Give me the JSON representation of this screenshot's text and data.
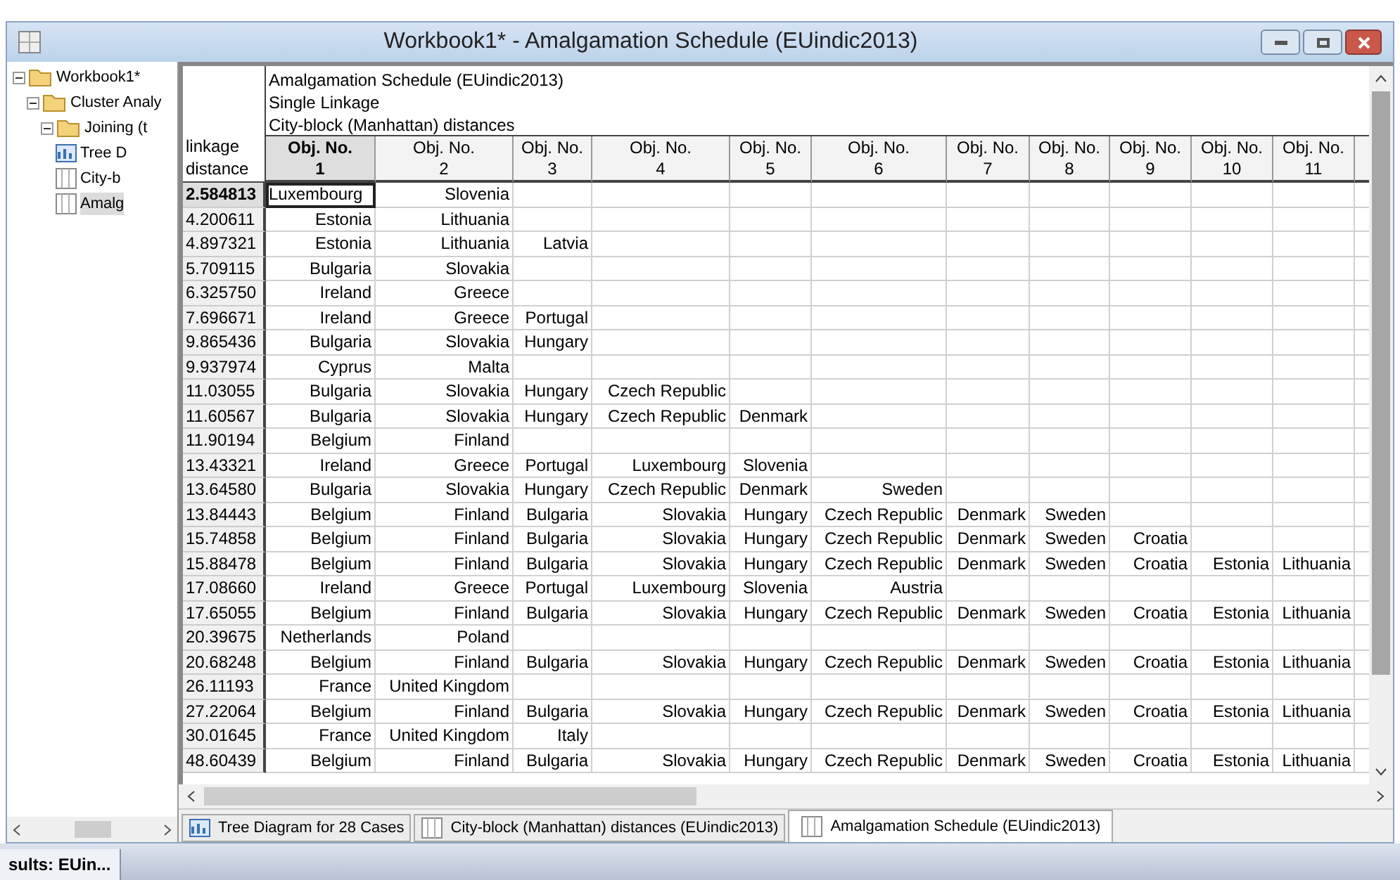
{
  "window": {
    "title": "Workbook1* - Amalgamation Schedule (EUindic2013)"
  },
  "tree": [
    {
      "label": "Workbook1*",
      "kind": "folder",
      "expanded": true,
      "selected": false,
      "children": [
        {
          "label": "Cluster Analy",
          "kind": "folder",
          "expanded": true,
          "selected": false,
          "children": [
            {
              "label": "Joining (t",
              "kind": "folder",
              "expanded": true,
              "selected": false,
              "children": [
                {
                  "label": "Tree D",
                  "kind": "graph",
                  "selected": false
                },
                {
                  "label": "City-b",
                  "kind": "sheet",
                  "selected": false
                },
                {
                  "label": "Amalg",
                  "kind": "sheet",
                  "selected": true
                }
              ]
            }
          ]
        }
      ]
    }
  ],
  "sheet": {
    "title_lines": [
      "Amalgamation Schedule (EUindic2013)",
      "Single Linkage",
      "City-block (Manhattan) distances"
    ],
    "corner_label": "linkage distance",
    "columns": [
      {
        "label": "Obj. No.",
        "number": "1",
        "selected": true
      },
      {
        "label": "Obj. No.",
        "number": "2",
        "selected": false
      },
      {
        "label": "Obj. No.",
        "number": "3",
        "selected": false
      },
      {
        "label": "Obj. No.",
        "number": "4",
        "selected": false
      },
      {
        "label": "Obj. No.",
        "number": "5",
        "selected": false
      },
      {
        "label": "Obj. No.",
        "number": "6",
        "selected": false
      },
      {
        "label": "Obj. No.",
        "number": "7",
        "selected": false
      },
      {
        "label": "Obj. No.",
        "number": "8",
        "selected": false
      },
      {
        "label": "Obj. No.",
        "number": "9",
        "selected": false
      },
      {
        "label": "Obj. No.",
        "number": "10",
        "selected": false
      },
      {
        "label": "Obj. No.",
        "number": "11",
        "selected": false
      }
    ],
    "rows": [
      {
        "distance": "2.584813",
        "selected": true,
        "cells": [
          "Luxembourg",
          "Slovenia"
        ]
      },
      {
        "distance": "4.200611",
        "selected": false,
        "cells": [
          "Estonia",
          "Lithuania"
        ]
      },
      {
        "distance": "4.897321",
        "selected": false,
        "cells": [
          "Estonia",
          "Lithuania",
          "Latvia"
        ]
      },
      {
        "distance": "5.709115",
        "selected": false,
        "cells": [
          "Bulgaria",
          "Slovakia"
        ]
      },
      {
        "distance": "6.325750",
        "selected": false,
        "cells": [
          "Ireland",
          "Greece"
        ]
      },
      {
        "distance": "7.696671",
        "selected": false,
        "cells": [
          "Ireland",
          "Greece",
          "Portugal"
        ]
      },
      {
        "distance": "9.865436",
        "selected": false,
        "cells": [
          "Bulgaria",
          "Slovakia",
          "Hungary"
        ]
      },
      {
        "distance": "9.937974",
        "selected": false,
        "cells": [
          "Cyprus",
          "Malta"
        ]
      },
      {
        "distance": "11.03055",
        "selected": false,
        "cells": [
          "Bulgaria",
          "Slovakia",
          "Hungary",
          "Czech Republic"
        ]
      },
      {
        "distance": "11.60567",
        "selected": false,
        "cells": [
          "Bulgaria",
          "Slovakia",
          "Hungary",
          "Czech Republic",
          "Denmark"
        ]
      },
      {
        "distance": "11.90194",
        "selected": false,
        "cells": [
          "Belgium",
          "Finland"
        ]
      },
      {
        "distance": "13.43321",
        "selected": false,
        "cells": [
          "Ireland",
          "Greece",
          "Portugal",
          "Luxembourg",
          "Slovenia"
        ]
      },
      {
        "distance": "13.64580",
        "selected": false,
        "cells": [
          "Bulgaria",
          "Slovakia",
          "Hungary",
          "Czech Republic",
          "Denmark",
          "Sweden"
        ]
      },
      {
        "distance": "13.84443",
        "selected": false,
        "cells": [
          "Belgium",
          "Finland",
          "Bulgaria",
          "Slovakia",
          "Hungary",
          "Czech Republic",
          "Denmark",
          "Sweden"
        ]
      },
      {
        "distance": "15.74858",
        "selected": false,
        "cells": [
          "Belgium",
          "Finland",
          "Bulgaria",
          "Slovakia",
          "Hungary",
          "Czech Republic",
          "Denmark",
          "Sweden",
          "Croatia"
        ]
      },
      {
        "distance": "15.88478",
        "selected": false,
        "cells": [
          "Belgium",
          "Finland",
          "Bulgaria",
          "Slovakia",
          "Hungary",
          "Czech Republic",
          "Denmark",
          "Sweden",
          "Croatia",
          "Estonia",
          "Lithuania"
        ]
      },
      {
        "distance": "17.08660",
        "selected": false,
        "cells": [
          "Ireland",
          "Greece",
          "Portugal",
          "Luxembourg",
          "Slovenia",
          "Austria"
        ]
      },
      {
        "distance": "17.65055",
        "selected": false,
        "cells": [
          "Belgium",
          "Finland",
          "Bulgaria",
          "Slovakia",
          "Hungary",
          "Czech Republic",
          "Denmark",
          "Sweden",
          "Croatia",
          "Estonia",
          "Lithuania"
        ]
      },
      {
        "distance": "20.39675",
        "selected": false,
        "cells": [
          "Netherlands",
          "Poland"
        ]
      },
      {
        "distance": "20.68248",
        "selected": false,
        "cells": [
          "Belgium",
          "Finland",
          "Bulgaria",
          "Slovakia",
          "Hungary",
          "Czech Republic",
          "Denmark",
          "Sweden",
          "Croatia",
          "Estonia",
          "Lithuania"
        ]
      },
      {
        "distance": "26.11193",
        "selected": false,
        "cells": [
          "France",
          "United Kingdom"
        ]
      },
      {
        "distance": "27.22064",
        "selected": false,
        "cells": [
          "Belgium",
          "Finland",
          "Bulgaria",
          "Slovakia",
          "Hungary",
          "Czech Republic",
          "Denmark",
          "Sweden",
          "Croatia",
          "Estonia",
          "Lithuania"
        ]
      },
      {
        "distance": "30.01645",
        "selected": false,
        "cells": [
          "France",
          "United Kingdom",
          "Italy"
        ]
      },
      {
        "distance": "48.60439",
        "selected": false,
        "cells": [
          "Belgium",
          "Finland",
          "Bulgaria",
          "Slovakia",
          "Hungary",
          "Czech Republic",
          "Denmark",
          "Sweden",
          "Croatia",
          "Estonia",
          "Lithuania"
        ]
      }
    ]
  },
  "tabs": [
    {
      "label": "Tree Diagram for 28 Cases",
      "kind": "graph",
      "selected": false
    },
    {
      "label": "City-block (Manhattan) distances (EUindic2013)",
      "kind": "sheet",
      "selected": false
    },
    {
      "label": "Amalgamation Schedule (EUindic2013)",
      "kind": "sheet",
      "selected": true
    }
  ],
  "taskbar": {
    "label": "sults: EUin..."
  }
}
